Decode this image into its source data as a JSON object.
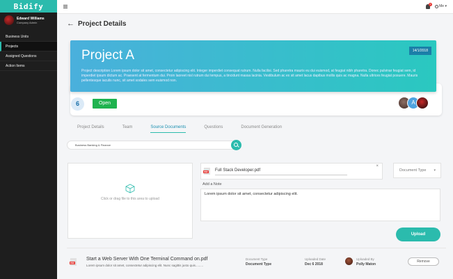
{
  "app": {
    "brand": "Bidify"
  },
  "user": {
    "name": "Edward Williams",
    "role": "Company Admin"
  },
  "sidebar": {
    "items": [
      {
        "label": "Business Units",
        "active": false
      },
      {
        "label": "Projects",
        "active": true
      },
      {
        "label": "Assigned Questions",
        "active": false
      },
      {
        "label": "Action Items",
        "active": false
      }
    ]
  },
  "topbar": {
    "notification_count": "1",
    "me_label": "Me"
  },
  "page": {
    "title": "Project Details"
  },
  "project": {
    "title": "Project A",
    "date": "14/1/2018",
    "description": "Project description Lorem ipsum dolor sit amet, consectetur adipiscing elit. Integer imperdiet consequat rutrum. Nulla facilisi. Sed pharetra mauris eu dui euismod, at feugiat nibh pharetra. Donec pulvinar feugiat sem, id imperdiet ipsum dictum ac. Praesent at fermentum dui. Proin laoreet nisl rutrum dui tempus, a tincidunt massa lacinia. Vestibulum ac ex sit amet lacus dapibus mollis quis ac magna. Nulla ultrices feugiat posuere. Mauris pellentesque iaculis nunc, sit amet sodales sem euismod non.",
    "count": "6",
    "status": "Open",
    "member_initial": "A"
  },
  "tabs": [
    {
      "label": "Project Details",
      "active": false
    },
    {
      "label": "Team",
      "active": false
    },
    {
      "label": "Source Documents",
      "active": true
    },
    {
      "label": "Questions",
      "active": false
    },
    {
      "label": "Document Generation",
      "active": false
    }
  ],
  "search": {
    "value": "Business Banking & Finance"
  },
  "upload": {
    "dropzone_text": "Click or drag file to this area to upload",
    "file_name": "Full Stack Developer.pdf",
    "document_type_placeholder": "Document Type",
    "note_label": "Add a Note",
    "note_value": "Lorem ipsum dolor sit amet, consectetur adipiscing elit.",
    "button_label": "Upload",
    "pdf_tag": "PDF"
  },
  "documents": [
    {
      "title": "Start a Web Server With One Terminal Command on.pdf",
      "subtitle": "Lorem ipsum dolor sit amet, consectetur adipiscing elit. Nunc sagittis justo quis.........",
      "type_label": "Document Type",
      "type_value": "Document Type",
      "date_label": "Uploaded Date",
      "date_value": "Dec 6 2018",
      "by_label": "Uploaded By",
      "by_value": "Polly Maton",
      "remove_label": "Remove"
    }
  ],
  "colors": {
    "accent": "#2bbbad",
    "banner_start": "#4ab0dc",
    "banner_end": "#2ac8c0",
    "status_open": "#1fb34f",
    "sidebar_bg": "#1e1e1e"
  },
  "icons": {
    "menu": "hamburger-icon",
    "bell": "bell-icon",
    "settings": "gear-icon",
    "back": "arrow-left-icon",
    "search": "search-icon",
    "upload": "cube-icon",
    "file": "pdf-icon",
    "close": "close-icon",
    "dropdown": "chevron-down-icon"
  }
}
